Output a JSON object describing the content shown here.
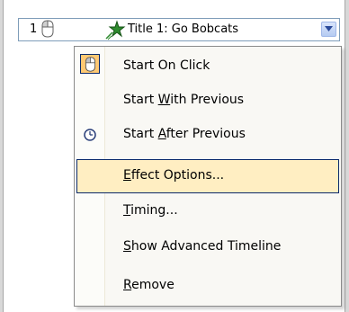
{
  "animation_row": {
    "order": "1",
    "title": "Title 1: Go Bobcats",
    "trigger_icon": "mouse-click-icon",
    "effect_icon": "star-effect-icon",
    "dropdown_icon": "chevron-down-icon"
  },
  "menu": {
    "items": [
      {
        "label": "Start On Click",
        "icon": "mouse-click-icon",
        "checked": true
      },
      {
        "label_pre": "Start ",
        "label_key": "W",
        "label_post": "ith Previous"
      },
      {
        "label_pre": "Start ",
        "label_key": "A",
        "label_post": "fter Previous",
        "icon": "clock-icon"
      },
      {
        "label_key": "E",
        "label_post": "ffect Options...",
        "highlighted": true
      },
      {
        "label_key": "T",
        "label_post": "iming..."
      },
      {
        "label_key": "S",
        "label_post": "how Advanced Timeline"
      },
      {
        "label_key": "R",
        "label_post": "emove"
      }
    ]
  },
  "colors": {
    "highlight_fill": "#ffeec2",
    "highlight_border": "#0b2a6b",
    "checked_fill": "#ffc973"
  }
}
